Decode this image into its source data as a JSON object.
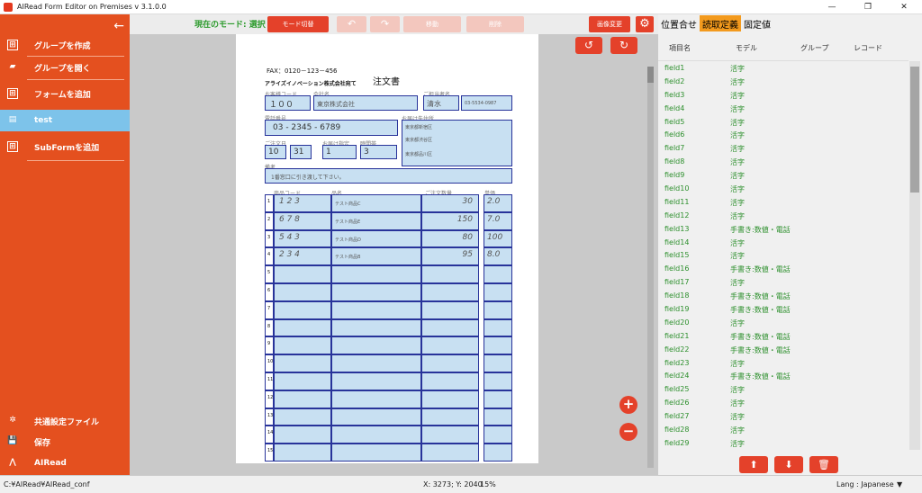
{
  "window": {
    "title": "AIRead Form Editor on Premises v 3.1.0.0",
    "minimize": "—",
    "maximize": "❐",
    "close": "✕"
  },
  "sidebar": {
    "back": "←",
    "items": [
      {
        "label": "グループを作成",
        "icon": "⊞"
      },
      {
        "label": "グループを開く",
        "icon": "▰"
      },
      {
        "label": "フォームを追加",
        "icon": "⊞"
      },
      {
        "label": "test",
        "icon": "▤"
      },
      {
        "label": "SubFormを追加",
        "icon": "⊞"
      }
    ],
    "bottom": [
      {
        "label": "共通設定ファイル",
        "icon": "✲"
      },
      {
        "label": "保存",
        "icon": "💾"
      },
      {
        "label": "AIRead",
        "icon": "⋀"
      }
    ]
  },
  "toolbar": {
    "mode_label": "現在のモード: 選択",
    "mode_switch": "モード切替",
    "undo": "↶",
    "redo": "↷",
    "disabled1": "移動",
    "disabled2": "削除",
    "image_change": "画像変更",
    "settings": "⚙"
  },
  "canvas": {
    "rotate_left": "↺",
    "rotate_right": "↻",
    "zoom_in": "+",
    "zoom_out": "−"
  },
  "document": {
    "fax": "FAX：0120－123－456",
    "title": "注文書",
    "company": "アライズイノベーション株式会社宛て",
    "h_customer_code": "お客様コード",
    "h_company": "会社名",
    "h_contact": "ご担当者名",
    "v_customer_code": "１００",
    "v_company": "東京株式会社",
    "v_contact": "清水",
    "v_tel_small": "03-5534-0987",
    "h_phone": "電話番号",
    "h_address": "お届け先住所",
    "v_phone": "03 - 2345 - 6789",
    "v_address1": "東京都新宿区",
    "v_address2": "東京都渋谷区",
    "v_address3": "東京都品川区",
    "h_date": "ご注文日",
    "h_month": "10",
    "h_day": "31",
    "h_delivery": "お届け指定",
    "h_time": "時間帯",
    "v_delivery": "1",
    "v_time": "3",
    "v_time_opts": "1:AM\n2:PM\n3:夜",
    "h_remarks": "備考",
    "v_remarks": "1番窓口に引き渡して下さい。",
    "h_item": "商品コード",
    "h_name": "品名",
    "h_qty": "ご注文数量",
    "h_price": "単価",
    "rows": [
      {
        "n": "1",
        "code": "1 2 3",
        "name": "テスト商品C",
        "qty": "30",
        "price": "2.0"
      },
      {
        "n": "2",
        "code": "6 7 8",
        "name": "テスト商品E",
        "qty": "150",
        "price": "7.0"
      },
      {
        "n": "3",
        "code": "5 4 3",
        "name": "テスト商品D",
        "qty": "80",
        "price": "100"
      },
      {
        "n": "4",
        "code": "2 3 4",
        "name": "テスト商品B",
        "qty": "95",
        "price": "8.0"
      },
      {
        "n": "5"
      },
      {
        "n": "6"
      },
      {
        "n": "7"
      },
      {
        "n": "8"
      },
      {
        "n": "9"
      },
      {
        "n": "10"
      },
      {
        "n": "11"
      },
      {
        "n": "12"
      },
      {
        "n": "13"
      },
      {
        "n": "14"
      },
      {
        "n": "15"
      }
    ]
  },
  "rpanel": {
    "tabs": [
      "位置合せ",
      "読取定義",
      "固定値"
    ],
    "headers": [
      "項目名",
      "モデル",
      "グループ",
      "レコード"
    ],
    "rows": [
      {
        "name": "field1",
        "model": "活字"
      },
      {
        "name": "field2",
        "model": "活字"
      },
      {
        "name": "field3",
        "model": "活字"
      },
      {
        "name": "field4",
        "model": "活字"
      },
      {
        "name": "field5",
        "model": "活字"
      },
      {
        "name": "field6",
        "model": "活字"
      },
      {
        "name": "field7",
        "model": "活字"
      },
      {
        "name": "field8",
        "model": "活字"
      },
      {
        "name": "field9",
        "model": "活字"
      },
      {
        "name": "field10",
        "model": "活字"
      },
      {
        "name": "field11",
        "model": "活字"
      },
      {
        "name": "field12",
        "model": "活字"
      },
      {
        "name": "field13",
        "model": "手書き:数値・電話"
      },
      {
        "name": "field14",
        "model": "活字"
      },
      {
        "name": "field15",
        "model": "活字"
      },
      {
        "name": "field16",
        "model": "手書き:数値・電話"
      },
      {
        "name": "field17",
        "model": "活字"
      },
      {
        "name": "field18",
        "model": "手書き:数値・電話"
      },
      {
        "name": "field19",
        "model": "手書き:数値・電話"
      },
      {
        "name": "field20",
        "model": "活字"
      },
      {
        "name": "field21",
        "model": "手書き:数値・電話"
      },
      {
        "name": "field22",
        "model": "手書き:数値・電話"
      },
      {
        "name": "field23",
        "model": "活字"
      },
      {
        "name": "field24",
        "model": "手書き:数値・電話"
      },
      {
        "name": "field25",
        "model": "活字"
      },
      {
        "name": "field26",
        "model": "活字"
      },
      {
        "name": "field27",
        "model": "活字"
      },
      {
        "name": "field28",
        "model": "活字"
      },
      {
        "name": "field29",
        "model": "活字"
      }
    ],
    "btn_up": "⬆",
    "btn_down": "⬇",
    "btn_delete": "🗑"
  },
  "status": {
    "path": "C:¥AIRead¥AIRead_conf",
    "coords": "X: 3273; Y: 2040",
    "zoom": "15%",
    "lang_label": "Lang : Japanese",
    "lang_arrow": "▼"
  }
}
